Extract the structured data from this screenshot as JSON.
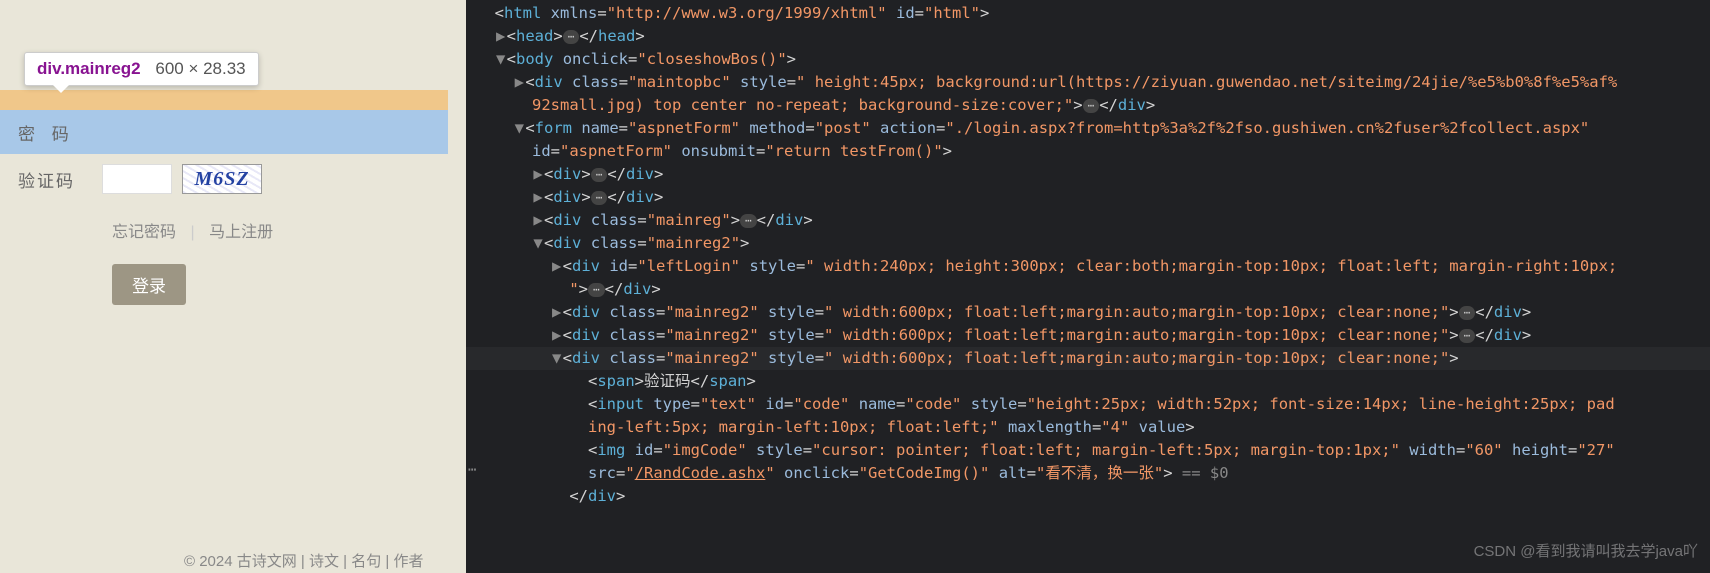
{
  "left": {
    "tooltip_tag": "div",
    "tooltip_class": ".mainreg2",
    "tooltip_dim": "600 × 28.33",
    "password_label": "密 码",
    "captcha_label": "验证码",
    "captcha_text": "M6SZ",
    "link_forgot": "忘记密码",
    "link_sep": "|",
    "link_register": "马上注册",
    "login_button": "登录",
    "footer": "© 2024 古诗文网 | 诗文 | 名句 | 作者"
  },
  "code": {
    "l0": "<html xmlns=\"http://www.w3.org/1999/xhtml\" id=\"html\">",
    "head_open": "<head>",
    "head_close": "</head>",
    "body_open": "<body onclick=\"closeshowBos()\">",
    "div_maintopbc_a": "<div class=\"maintopbc\" style=\" height:45px; background:url(https://ziyuan.guwendao.net/siteimg/24jie/%e5%b0%8f%e5%af%",
    "div_maintopbc_b": "92small.jpg) top center no-repeat; background-size:cover;\">",
    "div_maintopbc_close": "</div>",
    "form_a": "<form name=\"aspnetForm\" method=\"post\" action=\"./login.aspx?from=http%3a%2f%2fso.gushiwen.cn%2fuser%2fcollect.aspx\"",
    "form_b": "id=\"aspnetForm\" onsubmit=\"return testFrom()\">",
    "div_plain_open": "<div>",
    "div_plain_close": "</div>",
    "div_mainreg_open": "<div class=\"mainreg\">",
    "div_mainreg_close": "</div>",
    "div_mainreg2_open": "<div class=\"mainreg2\">",
    "div_leftlogin_a": "<div id=\"leftLogin\" style=\" width:240px; height:300px; clear:both;margin-top:10px; float:left; margin-right:10px;",
    "div_leftlogin_b": "\">",
    "div_leftlogin_close": "</div>",
    "div_row_style": "<div class=\"mainreg2\" style=\" width:600px; float:left;margin:auto;margin-top:10px; clear:none;\">",
    "div_close": "</div>",
    "span_captcha": "<span>验证码</span>",
    "input_a": "<input type=\"text\" id=\"code\" name=\"code\" style=\"height:25px; width:52px; font-size:14px; line-height:25px; pad",
    "input_b": "ing-left:5px; margin-left:10px; float:left;\" maxlength=\"4\" value>",
    "img_a": "<img id=\"imgCode\" style=\"cursor: pointer; float:left; margin-left:5px; margin-top:1px;\" width=\"60\" height=\"27\"",
    "img_b_src": "/RandCode.ashx",
    "img_b_onclick": "GetCodeImg()",
    "img_b_alt": "看不清，换一张",
    "eq0": " == $0",
    "watermark": "CSDN @看到我请叫我去学java吖"
  }
}
